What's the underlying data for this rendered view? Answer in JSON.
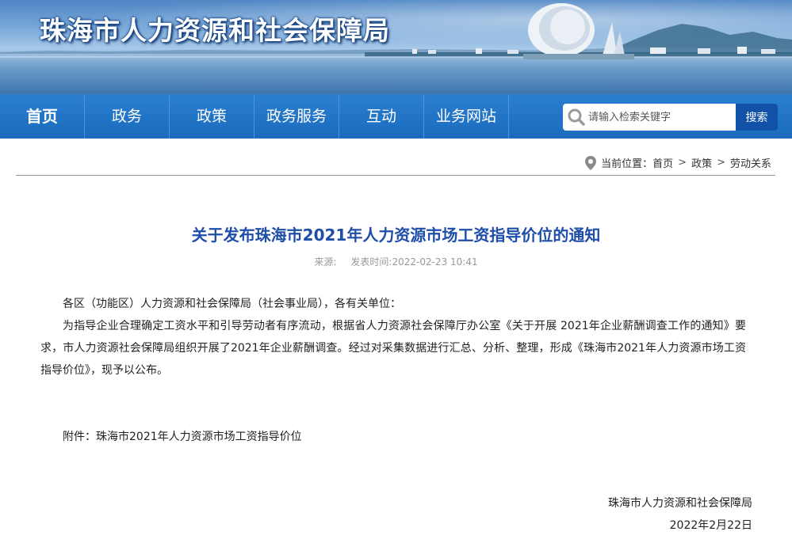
{
  "header": {
    "site_title": "珠海市人力资源和社会保障局"
  },
  "nav": {
    "items": [
      {
        "label": "首页"
      },
      {
        "label": "政务"
      },
      {
        "label": "政策"
      },
      {
        "label": "政务服务"
      },
      {
        "label": "互动"
      },
      {
        "label": "业务网站"
      }
    ],
    "active": "首页"
  },
  "search": {
    "placeholder": "请输入检索关键字",
    "button_label": "搜索"
  },
  "breadcrumb": {
    "prefix": "当前位置：",
    "items": [
      "首页",
      "政策",
      "劳动关系"
    ],
    "separator": ">"
  },
  "article": {
    "title": "关于发布珠海市2021年人力资源市场工资指导价位的通知",
    "source_label": "来源:",
    "publish_label": "发表时间:2022-02-23 10:41",
    "greeting": "各区（功能区）人力资源和社会保障局（社会事业局），各有关单位：",
    "body": "为指导企业合理确定工资水平和引导劳动者有序流动，根据省人力资源社会保障厅办公室《关于开展 2021年企业薪酬调查工作的通知》要求，市人力资源社会保障局组织开展了2021年企业薪酬调查。经过对采集数据进行汇总、分析、整理，形成《珠海市2021年人力资源市场工资指导价位》，现予以公布。",
    "attachment": "附件：珠海市2021年人力资源市场工资指导价位",
    "signature_org": "珠海市人力资源和社会保障局",
    "signature_date": "2022年2月22日"
  },
  "colors": {
    "nav_bg": "#1a6bbd",
    "search_button": "#1251a8",
    "title": "#1e4ea8"
  }
}
